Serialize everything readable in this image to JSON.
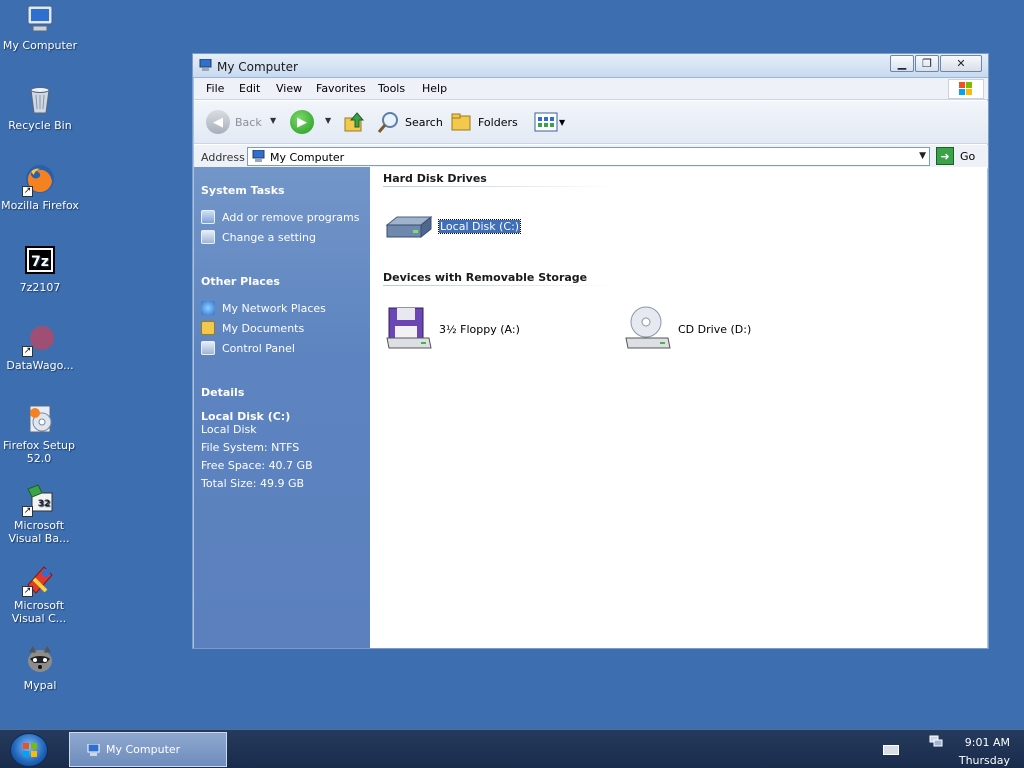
{
  "desktop": {
    "icons": [
      {
        "label": "My Computer",
        "icon": "my-computer-icon"
      },
      {
        "label": "Recycle Bin",
        "icon": "recycle-bin-icon"
      },
      {
        "label": "Mozilla Firefox",
        "icon": "firefox-icon"
      },
      {
        "label": "7z2107",
        "icon": "7zip-icon"
      },
      {
        "label": "DataWago...",
        "icon": "datawagon-icon"
      },
      {
        "label": "Firefox Setup 52.0",
        "icon": "installer-icon"
      },
      {
        "label": "Microsoft Visual Ba...",
        "icon": "visual-basic-icon"
      },
      {
        "label": "Microsoft Visual C...",
        "icon": "visual-c-icon"
      },
      {
        "label": "Mypal",
        "icon": "mypal-icon"
      }
    ]
  },
  "window": {
    "title": "My Computer",
    "menu": [
      "File",
      "Edit",
      "View",
      "Favorites",
      "Tools",
      "Help"
    ],
    "toolbar": {
      "back": "Back",
      "search": "Search",
      "folders": "Folders"
    },
    "address": {
      "label": "Address",
      "value": "My Computer",
      "go": "Go"
    }
  },
  "left_pane": {
    "system_tasks": {
      "title": "System Tasks",
      "items": [
        "Add or remove programs",
        "Change a setting"
      ]
    },
    "other_places": {
      "title": "Other Places",
      "items": [
        "My Network Places",
        "My Documents",
        "Control Panel"
      ]
    },
    "details": {
      "title": "Details",
      "name": "Local Disk (C:)",
      "type": "Local Disk",
      "file_system": "File System: NTFS",
      "free_space": "Free Space: 40.7 GB",
      "total_size": "Total Size: 49.9 GB"
    }
  },
  "content": {
    "hard_disk_header": "Hard Disk Drives",
    "hard_disks": [
      {
        "label": "Local Disk (C:)",
        "selected": true
      }
    ],
    "removable_header": "Devices with Removable Storage",
    "removable": [
      {
        "label": "3½ Floppy (A:)"
      },
      {
        "label": "CD Drive (D:)"
      }
    ]
  },
  "taskbar": {
    "task_label": "My Computer",
    "time": "9:01 AM",
    "day": "Thursday"
  },
  "colors": {
    "desktop": "#3c6eb0",
    "left_pane": "#5d84c0",
    "selection": "#3f6fb8"
  }
}
